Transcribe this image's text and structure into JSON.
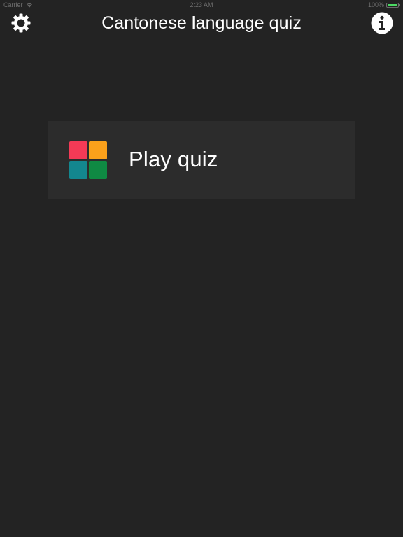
{
  "status_bar": {
    "carrier": "Carrier",
    "time": "2:23 AM",
    "battery": "100%",
    "battery_level": 1.0
  },
  "nav": {
    "title": "Cantonese language quiz",
    "left_icon": "gear-icon",
    "right_icon": "info-icon"
  },
  "main": {
    "play_label": "Play quiz",
    "logo_colors": [
      "#f43a56",
      "#fba11b",
      "#13878f",
      "#0f8a43"
    ]
  },
  "colors": {
    "background": "#232323",
    "card": "#2c2c2c",
    "text": "#ffffff",
    "battery": "#4cd964"
  }
}
